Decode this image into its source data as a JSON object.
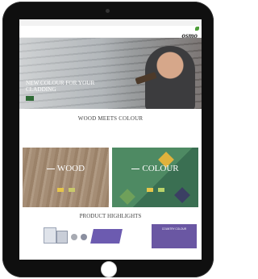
{
  "topbar": {
    "left": "",
    "links": [
      "",
      "",
      "",
      "",
      ""
    ]
  },
  "nav": {
    "items": [
      "",
      "",
      "",
      "",
      "",
      "",
      "",
      "",
      ""
    ],
    "logo": "osmo",
    "logo_tagline": ""
  },
  "hero": {
    "title": "NEW COLOUR FOR YOUR CLADDING",
    "button_label": ""
  },
  "intro": {
    "heading": "WOOD MEETS COLOUR",
    "text": ""
  },
  "panels": [
    {
      "title": "WOOD",
      "text": "",
      "buttons": [
        "",
        ""
      ],
      "button_colors": [
        "#e6c54a",
        "#c9c96a"
      ]
    },
    {
      "title": "COLOUR",
      "text": "",
      "buttons": [
        "",
        ""
      ],
      "button_colors": [
        "#e6c54a",
        "#b9d36a"
      ]
    }
  ],
  "highlights": {
    "heading": "PRODUCT HIGHLIGHTS",
    "promo_text": "COUNTRY COLOUR"
  },
  "colors": {
    "brand_green": "#2f6b36",
    "promo_purple": "#6a57a3"
  },
  "icons": {
    "logo_leaf": "leaf-icon"
  }
}
